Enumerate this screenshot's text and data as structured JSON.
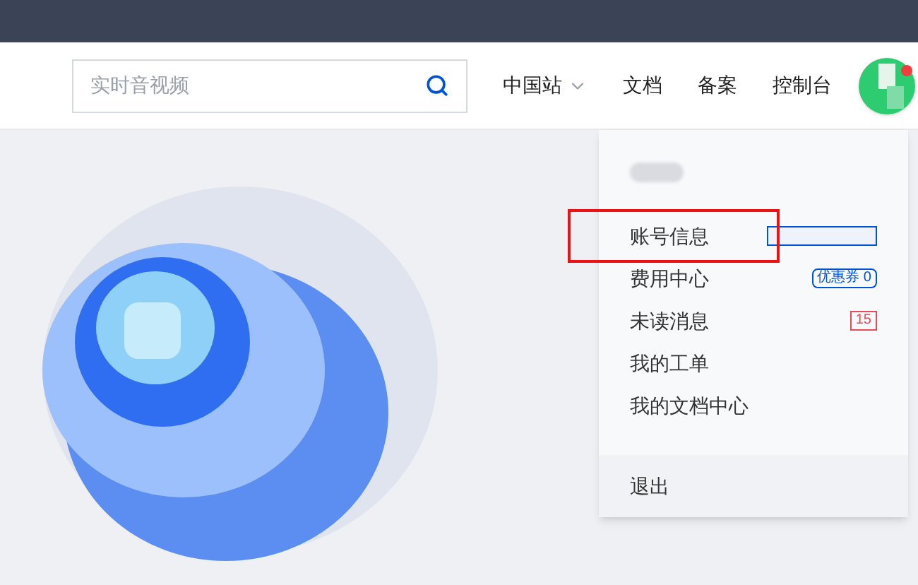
{
  "search": {
    "placeholder": "实时音视频"
  },
  "nav": [
    {
      "label": "中国站",
      "kind": "dropdown"
    },
    {
      "label": "文档",
      "kind": "link"
    },
    {
      "label": "备案",
      "kind": "link"
    },
    {
      "label": "控制台",
      "kind": "link"
    }
  ],
  "avatar": {
    "notification": true
  },
  "menu": {
    "items": [
      {
        "label": "账号信息",
        "kind": "blurred",
        "highlighted": true
      },
      {
        "label": "费用中心",
        "kind": "coupon",
        "badge": "优惠券 0"
      },
      {
        "label": "未读消息",
        "kind": "message",
        "badge": "15"
      },
      {
        "label": "我的工单",
        "kind": "plain"
      },
      {
        "label": "我的文档中心",
        "kind": "plain"
      }
    ],
    "logout": "退出"
  }
}
